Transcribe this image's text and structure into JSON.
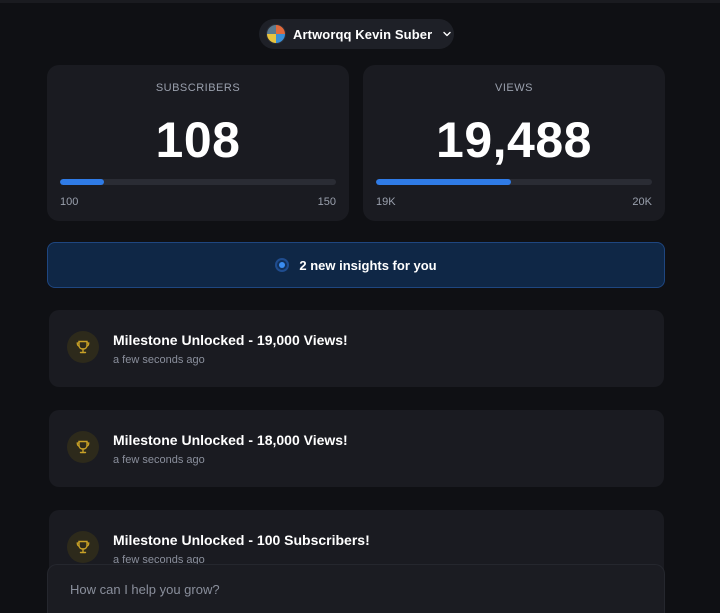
{
  "channel": {
    "name": "Artworqq Kevin Suber",
    "avatar_icon": "channel-avatar"
  },
  "stats": [
    {
      "label": "SUBSCRIBERS",
      "value": "108",
      "min": "100",
      "max": "150",
      "progress": 0.16
    },
    {
      "label": "VIEWS",
      "value": "19,488",
      "min": "19K",
      "max": "20K",
      "progress": 0.49
    }
  ],
  "insights": {
    "text": "2 new insights for you"
  },
  "milestones": [
    {
      "title": "Milestone Unlocked - 19,000 Views!",
      "time": "a few seconds ago",
      "icon": "trophy-icon"
    },
    {
      "title": "Milestone Unlocked - 18,000 Views!",
      "time": "a few seconds ago",
      "icon": "trophy-icon"
    },
    {
      "title": "Milestone Unlocked - 100 Subscribers!",
      "time": "a few seconds ago",
      "icon": "trophy-icon"
    }
  ],
  "chat": {
    "placeholder": "How can I help you grow?"
  },
  "colors": {
    "accent": "#2f7be6",
    "background": "#0f1014",
    "card": "#1a1b21",
    "trophy": "#c9a227"
  }
}
